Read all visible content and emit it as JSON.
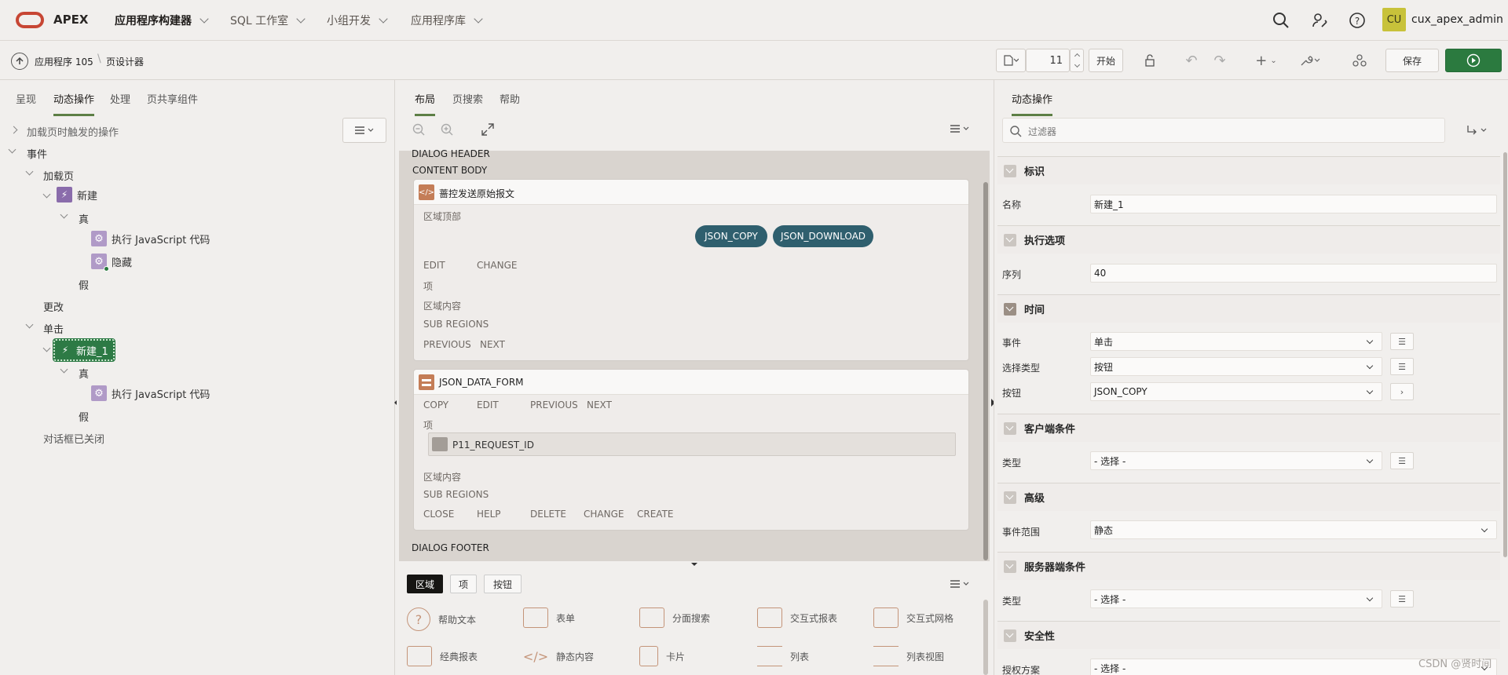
{
  "topbar": {
    "logo_text": "APEX",
    "nav": [
      "应用程序构建器",
      "SQL 工作室",
      "小组开发",
      "应用程序库"
    ],
    "user_initials": "CU",
    "username": "cux_apex_admin"
  },
  "breadcrumb": {
    "app": "应用程序 105",
    "page": "页设计器"
  },
  "toolbar": {
    "page_number": "11",
    "go_label": "开始",
    "save_label": "保存"
  },
  "left": {
    "tabs": [
      "呈现",
      "动态操作",
      "处理",
      "页共享组件"
    ],
    "tree": {
      "page_load_actions": "加载页时触发的操作",
      "events": "事件",
      "page_load": "加载页",
      "new": "新建",
      "true": "真",
      "exec_js": "执行 JavaScript 代码",
      "hide": "隐藏",
      "false": "假",
      "change": "更改",
      "click": "单击",
      "new_1": "新建_1",
      "true2": "真",
      "exec_js2": "执行 JavaScript 代码",
      "false2": "假",
      "dialog_closed": "对话框已关闭"
    }
  },
  "middle": {
    "tabs": [
      "布局",
      "页搜索",
      "帮助"
    ],
    "dialog_header": "DIALOG HEADER",
    "content_body": "CONTENT BODY",
    "dialog_footer": "DIALOG FOOTER",
    "region1": {
      "title": "蔷控发送原始报文",
      "top_label": "区域顶部",
      "btn1": "JSON_COPY",
      "btn2": "JSON_DOWNLOAD",
      "edit": "EDIT",
      "change": "CHANGE",
      "items": "项",
      "content": "区域内容",
      "sub": "SUB REGIONS",
      "prev": "PREVIOUS",
      "next": "NEXT"
    },
    "region2": {
      "title": "JSON_DATA_FORM",
      "copy": "COPY",
      "edit": "EDIT",
      "prev": "PREVIOUS",
      "next": "NEXT",
      "items": "项",
      "item_name": "P11_REQUEST_ID",
      "content": "区域内容",
      "sub": "SUB REGIONS",
      "close": "CLOSE",
      "help": "HELP",
      "delete": "DELETE",
      "change": "CHANGE",
      "create": "CREATE"
    },
    "gallery_tabs": [
      "区域",
      "项",
      "按钮"
    ],
    "gallery": [
      "帮助文本",
      "表单",
      "分面搜索",
      "交互式报表",
      "交互式网格",
      "经典报表",
      "静态内容",
      "卡片",
      "列表",
      "列表视图"
    ]
  },
  "right": {
    "tab": "动态操作",
    "filter_placeholder": "过滤器",
    "sections": {
      "identification": "标识",
      "name_label": "名称",
      "name_value": "新建_1",
      "execution": "执行选项",
      "sequence_label": "序列",
      "sequence_value": "40",
      "when": "时间",
      "event_label": "事件",
      "event_value": "单击",
      "selection_label": "选择类型",
      "selection_value": "按钮",
      "button_label": "按钮",
      "button_value": "JSON_COPY",
      "client_condition": "客户端条件",
      "type_label": "类型",
      "type_value": "- 选择 -",
      "advanced": "高级",
      "event_scope_label": "事件范围",
      "event_scope_value": "静态",
      "server_condition": "服务器端条件",
      "server_type_label": "类型",
      "server_type_value": "- 选择 -",
      "security": "安全性",
      "auth_label": "授权方案",
      "auth_value": "- 选择 -"
    }
  },
  "watermark": "CSDN @贤时间"
}
